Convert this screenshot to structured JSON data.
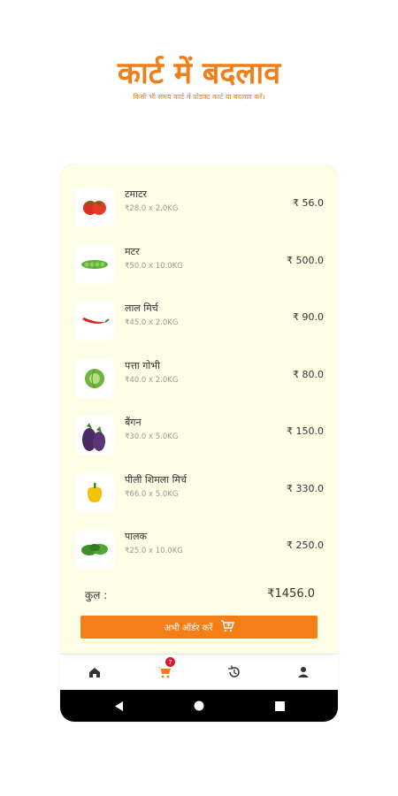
{
  "promo": {
    "title": "कार्ट में बदलाव",
    "subtitle": "किसी भी समय कार्ट में प्रोडक्ट कार्ट या बदलाव करें।"
  },
  "cart": {
    "items": [
      {
        "name": "टमाटर",
        "qty": "₹28.0 x 2.0KG",
        "total": "₹ 56.0",
        "icon": "tomato-icon"
      },
      {
        "name": "मटर",
        "qty": "₹50.0 x 10.0KG",
        "total": "₹ 500.0",
        "icon": "peas-icon"
      },
      {
        "name": "लाल मिर्च",
        "qty": "₹45.0 x 2.0KG",
        "total": "₹ 90.0",
        "icon": "red-chilli-icon"
      },
      {
        "name": "पत्ता गोभी",
        "qty": "₹40.0 x 2.0KG",
        "total": "₹ 80.0",
        "icon": "cabbage-icon"
      },
      {
        "name": "बैंगन",
        "qty": "₹30.0 x 5.0KG",
        "total": "₹ 150.0",
        "icon": "brinjal-icon"
      },
      {
        "name": "पीली शिमला मिर्च",
        "qty": "₹66.0 x 5.0KG",
        "total": "₹ 330.0",
        "icon": "yellow-capsicum-icon"
      },
      {
        "name": "पालक",
        "qty": "₹25.0 x 10.0KG",
        "total": "₹ 250.0",
        "icon": "spinach-icon"
      }
    ],
    "total_label": "कुल :",
    "total_value": "₹1456.0",
    "order_button": "अभी ऑर्डर करें"
  },
  "bottom_nav": {
    "badge_count": "7",
    "items": [
      "home-icon",
      "cart-icon",
      "history-icon",
      "profile-icon"
    ]
  },
  "colors": {
    "accent": "#f47f18",
    "background": "#fefde6",
    "badge": "#d8182a"
  }
}
